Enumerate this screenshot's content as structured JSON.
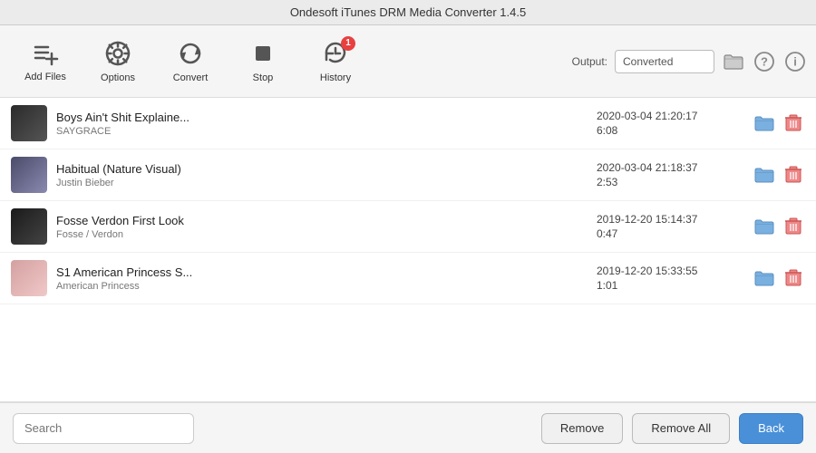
{
  "window": {
    "title": "Ondesoft iTunes DRM Media Converter 1.4.5"
  },
  "toolbar": {
    "add_files_label": "Add Files",
    "options_label": "Options",
    "convert_label": "Convert",
    "stop_label": "Stop",
    "history_label": "History",
    "history_badge": "1",
    "output_label": "Output:",
    "output_value": "Converted"
  },
  "files": [
    {
      "id": 1,
      "title": "Boys Ain't Shit Explaine...",
      "artist": "SAYGRACE",
      "date": "2020-03-04 21:20:17",
      "duration": "6:08",
      "thumb_class": "thumb-boys"
    },
    {
      "id": 2,
      "title": "Habitual (Nature Visual)",
      "artist": "Justin Bieber",
      "date": "2020-03-04 21:18:37",
      "duration": "2:53",
      "thumb_class": "thumb-habitual"
    },
    {
      "id": 3,
      "title": "Fosse Verdon  First Look",
      "artist": "Fosse / Verdon",
      "date": "2019-12-20 15:14:37",
      "duration": "0:47",
      "thumb_class": "thumb-fosse"
    },
    {
      "id": 4,
      "title": "S1 American Princess S...",
      "artist": "American Princess",
      "date": "2019-12-20 15:33:55",
      "duration": "1:01",
      "thumb_class": "thumb-princess"
    }
  ],
  "bottom": {
    "search_placeholder": "Search",
    "remove_label": "Remove",
    "remove_all_label": "Remove All",
    "back_label": "Back"
  }
}
